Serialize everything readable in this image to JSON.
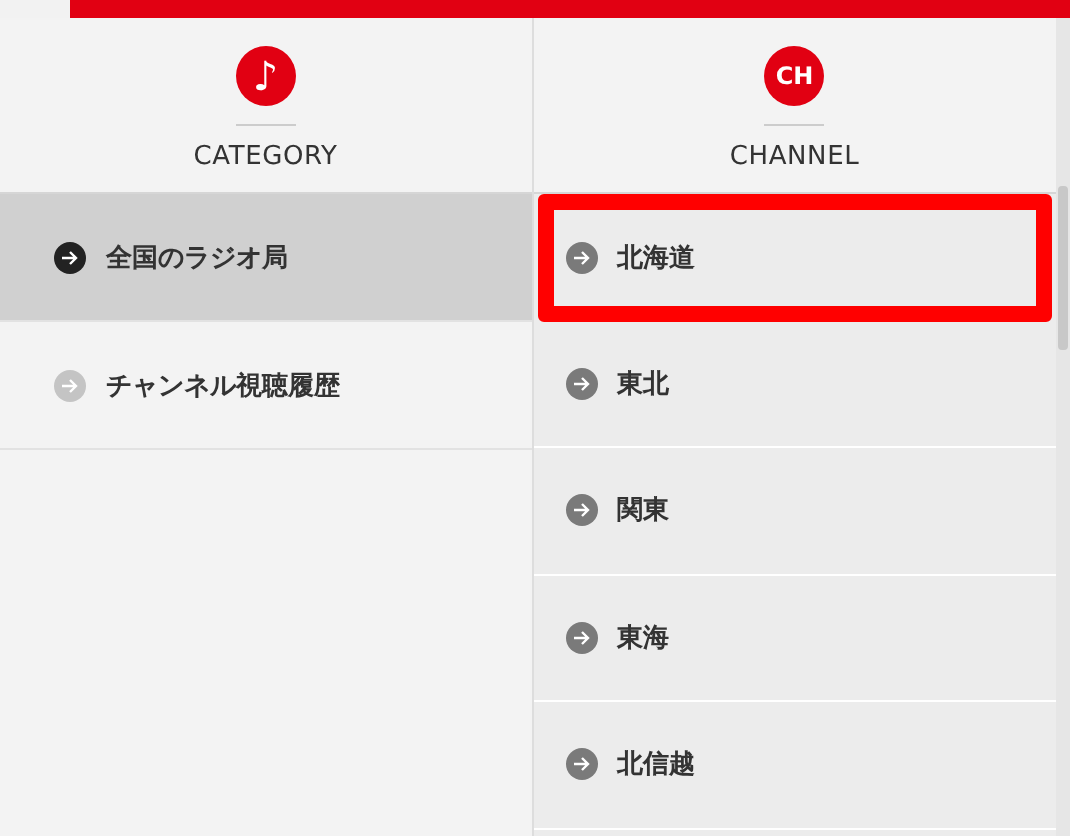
{
  "columns": [
    {
      "kind": "category",
      "icon": "♪",
      "heading": "CATEGORY"
    },
    {
      "kind": "channel",
      "icon": "CH",
      "heading": "CHANNEL"
    }
  ],
  "categories": [
    {
      "label": "全国のラジオ局",
      "selected": true
    },
    {
      "label": "チャンネル視聴履歴",
      "selected": false
    }
  ],
  "channels": [
    {
      "label": "北海道",
      "highlighted": true
    },
    {
      "label": "東北",
      "highlighted": false
    },
    {
      "label": "関東",
      "highlighted": false
    },
    {
      "label": "東海",
      "highlighted": false
    },
    {
      "label": "北信越",
      "highlighted": false
    }
  ]
}
